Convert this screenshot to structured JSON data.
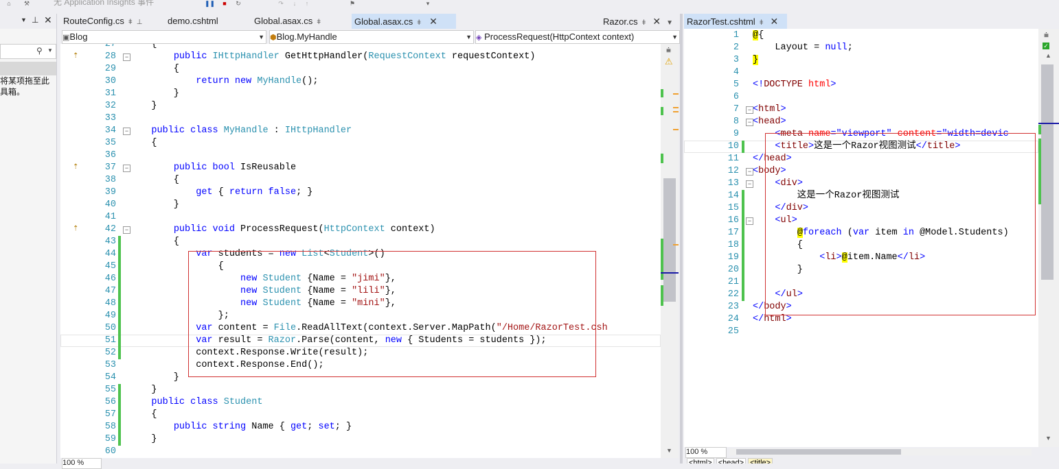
{
  "toolbar": {
    "text": "无 Application Insights 事件"
  },
  "toolbox": {
    "message_line1": "将某项拖至此",
    "message_line2": "具箱。"
  },
  "left_tabs": [
    {
      "label": "RouteConfig.cs"
    },
    {
      "label": "demo.cshtml"
    },
    {
      "label": "Global.asax.cs"
    },
    {
      "label": "Global.asax.cs"
    },
    {
      "label": "Razor.cs"
    }
  ],
  "left_nav": {
    "project": "Blog",
    "class": "Blog.MyHandle",
    "member": "ProcessRequest(HttpContext context)"
  },
  "left_code": [
    {
      "n": "27",
      "t": [
        [
          "",
          "    {"
        ]
      ]
    },
    {
      "n": "28",
      "t": [
        [
          "",
          "        "
        ],
        [
          "kw",
          "public "
        ],
        [
          "ty",
          "IHttpHandler"
        ],
        [
          "",
          " GetHttpHandler("
        ],
        [
          "ty",
          "RequestContext"
        ],
        [
          "",
          " requestContext)"
        ]
      ]
    },
    {
      "n": "29",
      "t": [
        [
          "",
          "        {"
        ]
      ]
    },
    {
      "n": "30",
      "t": [
        [
          "",
          "            "
        ],
        [
          "kw",
          "return new "
        ],
        [
          "ty",
          "MyHandle"
        ],
        [
          "",
          "();"
        ]
      ]
    },
    {
      "n": "31",
      "t": [
        [
          "",
          "        }"
        ]
      ]
    },
    {
      "n": "32",
      "t": [
        [
          "",
          "    }"
        ]
      ]
    },
    {
      "n": "33",
      "t": [
        [
          "",
          ""
        ]
      ]
    },
    {
      "n": "34",
      "t": [
        [
          "",
          "    "
        ],
        [
          "kw",
          "public class "
        ],
        [
          "ty",
          "MyHandle"
        ],
        [
          "",
          " : "
        ],
        [
          "ty",
          "IHttpHandler"
        ]
      ]
    },
    {
      "n": "35",
      "t": [
        [
          "",
          "    {"
        ]
      ]
    },
    {
      "n": "36",
      "t": [
        [
          "",
          ""
        ]
      ]
    },
    {
      "n": "37",
      "t": [
        [
          "",
          "        "
        ],
        [
          "kw",
          "public bool"
        ],
        [
          "",
          " IsReusable"
        ]
      ]
    },
    {
      "n": "38",
      "t": [
        [
          "",
          "        {"
        ]
      ]
    },
    {
      "n": "39",
      "t": [
        [
          "",
          "            "
        ],
        [
          "kw",
          "get"
        ],
        [
          "",
          " { "
        ],
        [
          "kw",
          "return false"
        ],
        [
          "",
          "; }"
        ]
      ]
    },
    {
      "n": "40",
      "t": [
        [
          "",
          "        }"
        ]
      ]
    },
    {
      "n": "41",
      "t": [
        [
          "",
          ""
        ]
      ]
    },
    {
      "n": "42",
      "t": [
        [
          "",
          "        "
        ],
        [
          "kw",
          "public void"
        ],
        [
          "",
          " ProcessRequest("
        ],
        [
          "ty",
          "HttpContext"
        ],
        [
          "",
          " context)"
        ]
      ]
    },
    {
      "n": "43",
      "t": [
        [
          "",
          "        {"
        ]
      ]
    },
    {
      "n": "44",
      "t": [
        [
          "",
          "            "
        ],
        [
          "kw",
          "var"
        ],
        [
          "",
          " students = "
        ],
        [
          "kw",
          "new "
        ],
        [
          "ty",
          "List"
        ],
        [
          "",
          "<"
        ],
        [
          "ty",
          "Student"
        ],
        [
          "",
          ">()"
        ]
      ]
    },
    {
      "n": "45",
      "t": [
        [
          "",
          "                {"
        ]
      ]
    },
    {
      "n": "46",
      "t": [
        [
          "",
          "                    "
        ],
        [
          "kw",
          "new "
        ],
        [
          "ty",
          "Student"
        ],
        [
          "",
          " {Name = "
        ],
        [
          "st",
          "\"jimi\""
        ],
        [
          "",
          "},"
        ]
      ]
    },
    {
      "n": "47",
      "t": [
        [
          "",
          "                    "
        ],
        [
          "kw",
          "new "
        ],
        [
          "ty",
          "Student"
        ],
        [
          "",
          " {Name = "
        ],
        [
          "st",
          "\"lili\""
        ],
        [
          "",
          "},"
        ]
      ]
    },
    {
      "n": "48",
      "t": [
        [
          "",
          "                    "
        ],
        [
          "kw",
          "new "
        ],
        [
          "ty",
          "Student"
        ],
        [
          "",
          " {Name = "
        ],
        [
          "st",
          "\"mini\""
        ],
        [
          "",
          "},"
        ]
      ]
    },
    {
      "n": "49",
      "t": [
        [
          "",
          "                };"
        ]
      ]
    },
    {
      "n": "50",
      "t": [
        [
          "",
          "            "
        ],
        [
          "kw",
          "var"
        ],
        [
          "",
          " content = "
        ],
        [
          "ty",
          "File"
        ],
        [
          "",
          ".ReadAllText(context.Server.MapPath("
        ],
        [
          "st",
          "\"/Home/RazorTest.csh"
        ]
      ]
    },
    {
      "n": "51",
      "t": [
        [
          "",
          "            "
        ],
        [
          "kw",
          "var"
        ],
        [
          "",
          " result = "
        ],
        [
          "ty",
          "Razor"
        ],
        [
          "",
          ".Parse(content, "
        ],
        [
          "kw",
          "new"
        ],
        [
          "",
          " { Students = students });"
        ]
      ]
    },
    {
      "n": "52",
      "t": [
        [
          "",
          "            context.Response.Write(result);"
        ]
      ]
    },
    {
      "n": "53",
      "t": [
        [
          "",
          "            context.Response.End();"
        ]
      ]
    },
    {
      "n": "54",
      "t": [
        [
          "",
          "        }"
        ]
      ]
    },
    {
      "n": "55",
      "t": [
        [
          "",
          "    }"
        ]
      ]
    },
    {
      "n": "56",
      "t": [
        [
          "",
          "    "
        ],
        [
          "kw",
          "public class "
        ],
        [
          "ty",
          "Student"
        ]
      ]
    },
    {
      "n": "57",
      "t": [
        [
          "",
          "    {"
        ]
      ]
    },
    {
      "n": "58",
      "t": [
        [
          "",
          "        "
        ],
        [
          "kw",
          "public string"
        ],
        [
          "",
          " Name { "
        ],
        [
          "kw",
          "get"
        ],
        [
          "",
          "; "
        ],
        [
          "kw",
          "set"
        ],
        [
          "",
          "; }"
        ]
      ]
    },
    {
      "n": "59",
      "t": [
        [
          "",
          "    }"
        ]
      ]
    },
    {
      "n": "60",
      "t": [
        [
          "",
          ""
        ]
      ]
    }
  ],
  "left_zoom": "100 %",
  "right_tab": {
    "label": "RazorTest.cshtml"
  },
  "right_code": [
    {
      "n": "1",
      "t": [
        [
          "hl",
          "@"
        ],
        [
          "",
          "{"
        ]
      ]
    },
    {
      "n": "2",
      "t": [
        [
          "",
          "    Layout = "
        ],
        [
          "kw",
          "null"
        ],
        [
          "",
          ";"
        ]
      ]
    },
    {
      "n": "3",
      "t": [
        [
          "hl",
          "}"
        ]
      ]
    },
    {
      "n": "4",
      "t": [
        [
          "",
          ""
        ]
      ]
    },
    {
      "n": "5",
      "t": [
        [
          "kw",
          "<!"
        ],
        [
          "tg",
          "DOCTYPE "
        ],
        [
          "at",
          "html"
        ],
        [
          "kw",
          ">"
        ]
      ]
    },
    {
      "n": "6",
      "t": [
        [
          "",
          ""
        ]
      ]
    },
    {
      "n": "7",
      "t": [
        [
          "kw",
          "<"
        ],
        [
          "tg",
          "html"
        ],
        [
          "kw",
          ">"
        ]
      ]
    },
    {
      "n": "8",
      "t": [
        [
          "kw",
          "<"
        ],
        [
          "tg",
          "head"
        ],
        [
          "kw",
          ">"
        ]
      ]
    },
    {
      "n": "9",
      "t": [
        [
          "",
          "    "
        ],
        [
          "kw",
          "<"
        ],
        [
          "tg",
          "meta "
        ],
        [
          "at",
          "name"
        ],
        [
          "kw",
          "=\"viewport\" "
        ],
        [
          "at",
          "content"
        ],
        [
          "kw",
          "=\"width=devic"
        ]
      ]
    },
    {
      "n": "10",
      "t": [
        [
          "",
          "    "
        ],
        [
          "kw",
          "<"
        ],
        [
          "tg",
          "title"
        ],
        [
          "kw",
          ">"
        ],
        [
          "",
          "这是一个Razor视图测试"
        ],
        [
          "kw",
          "</"
        ],
        [
          "tg",
          "title"
        ],
        [
          "kw",
          ">"
        ]
      ]
    },
    {
      "n": "11",
      "t": [
        [
          "kw",
          "</"
        ],
        [
          "tg",
          "head"
        ],
        [
          "kw",
          ">"
        ]
      ]
    },
    {
      "n": "12",
      "t": [
        [
          "kw",
          "<"
        ],
        [
          "tg",
          "body"
        ],
        [
          "kw",
          ">"
        ]
      ]
    },
    {
      "n": "13",
      "t": [
        [
          "",
          "    "
        ],
        [
          "kw",
          "<"
        ],
        [
          "tg",
          "div"
        ],
        [
          "kw",
          ">"
        ]
      ]
    },
    {
      "n": "14",
      "t": [
        [
          "",
          "        这是一个Razor视图测试"
        ]
      ]
    },
    {
      "n": "15",
      "t": [
        [
          "",
          "    "
        ],
        [
          "kw",
          "</"
        ],
        [
          "tg",
          "div"
        ],
        [
          "kw",
          ">"
        ]
      ]
    },
    {
      "n": "16",
      "t": [
        [
          "",
          "    "
        ],
        [
          "kw",
          "<"
        ],
        [
          "tg",
          "ul"
        ],
        [
          "kw",
          ">"
        ]
      ]
    },
    {
      "n": "17",
      "t": [
        [
          "",
          "        "
        ],
        [
          "hl",
          "@"
        ],
        [
          "kw",
          "foreach"
        ],
        [
          "",
          " ("
        ],
        [
          "kw",
          "var"
        ],
        [
          "",
          " item "
        ],
        [
          "kw",
          "in"
        ],
        [
          "",
          " @Model.Students)"
        ]
      ]
    },
    {
      "n": "18",
      "t": [
        [
          "",
          "        {"
        ]
      ]
    },
    {
      "n": "19",
      "t": [
        [
          "",
          "            "
        ],
        [
          "kw",
          "<"
        ],
        [
          "tg",
          "li"
        ],
        [
          "kw",
          ">"
        ],
        [
          "hl",
          "@"
        ],
        [
          "",
          "item.Name"
        ],
        [
          "kw",
          "</"
        ],
        [
          "tg",
          "li"
        ],
        [
          "kw",
          ">"
        ]
      ]
    },
    {
      "n": "20",
      "t": [
        [
          "",
          "        }"
        ]
      ]
    },
    {
      "n": "21",
      "t": [
        [
          "",
          ""
        ]
      ]
    },
    {
      "n": "22",
      "t": [
        [
          "",
          "    "
        ],
        [
          "kw",
          "</"
        ],
        [
          "tg",
          "ul"
        ],
        [
          "kw",
          ">"
        ]
      ]
    },
    {
      "n": "23",
      "t": [
        [
          "kw",
          "</"
        ],
        [
          "tg",
          "body"
        ],
        [
          "kw",
          ">"
        ]
      ]
    },
    {
      "n": "24",
      "t": [
        [
          "kw",
          "</"
        ],
        [
          "tg",
          "html"
        ],
        [
          "kw",
          ">"
        ]
      ]
    },
    {
      "n": "25",
      "t": [
        [
          "",
          ""
        ]
      ]
    }
  ],
  "right_zoom": "100 %",
  "right_breadcrumb": [
    "<html>",
    "<head>",
    "<title>"
  ],
  "colors": {
    "keyword": "#0000ff",
    "type": "#2b91af",
    "string": "#a31515",
    "change_bar": "#4ec24e",
    "annotation_box": "#d03030"
  }
}
